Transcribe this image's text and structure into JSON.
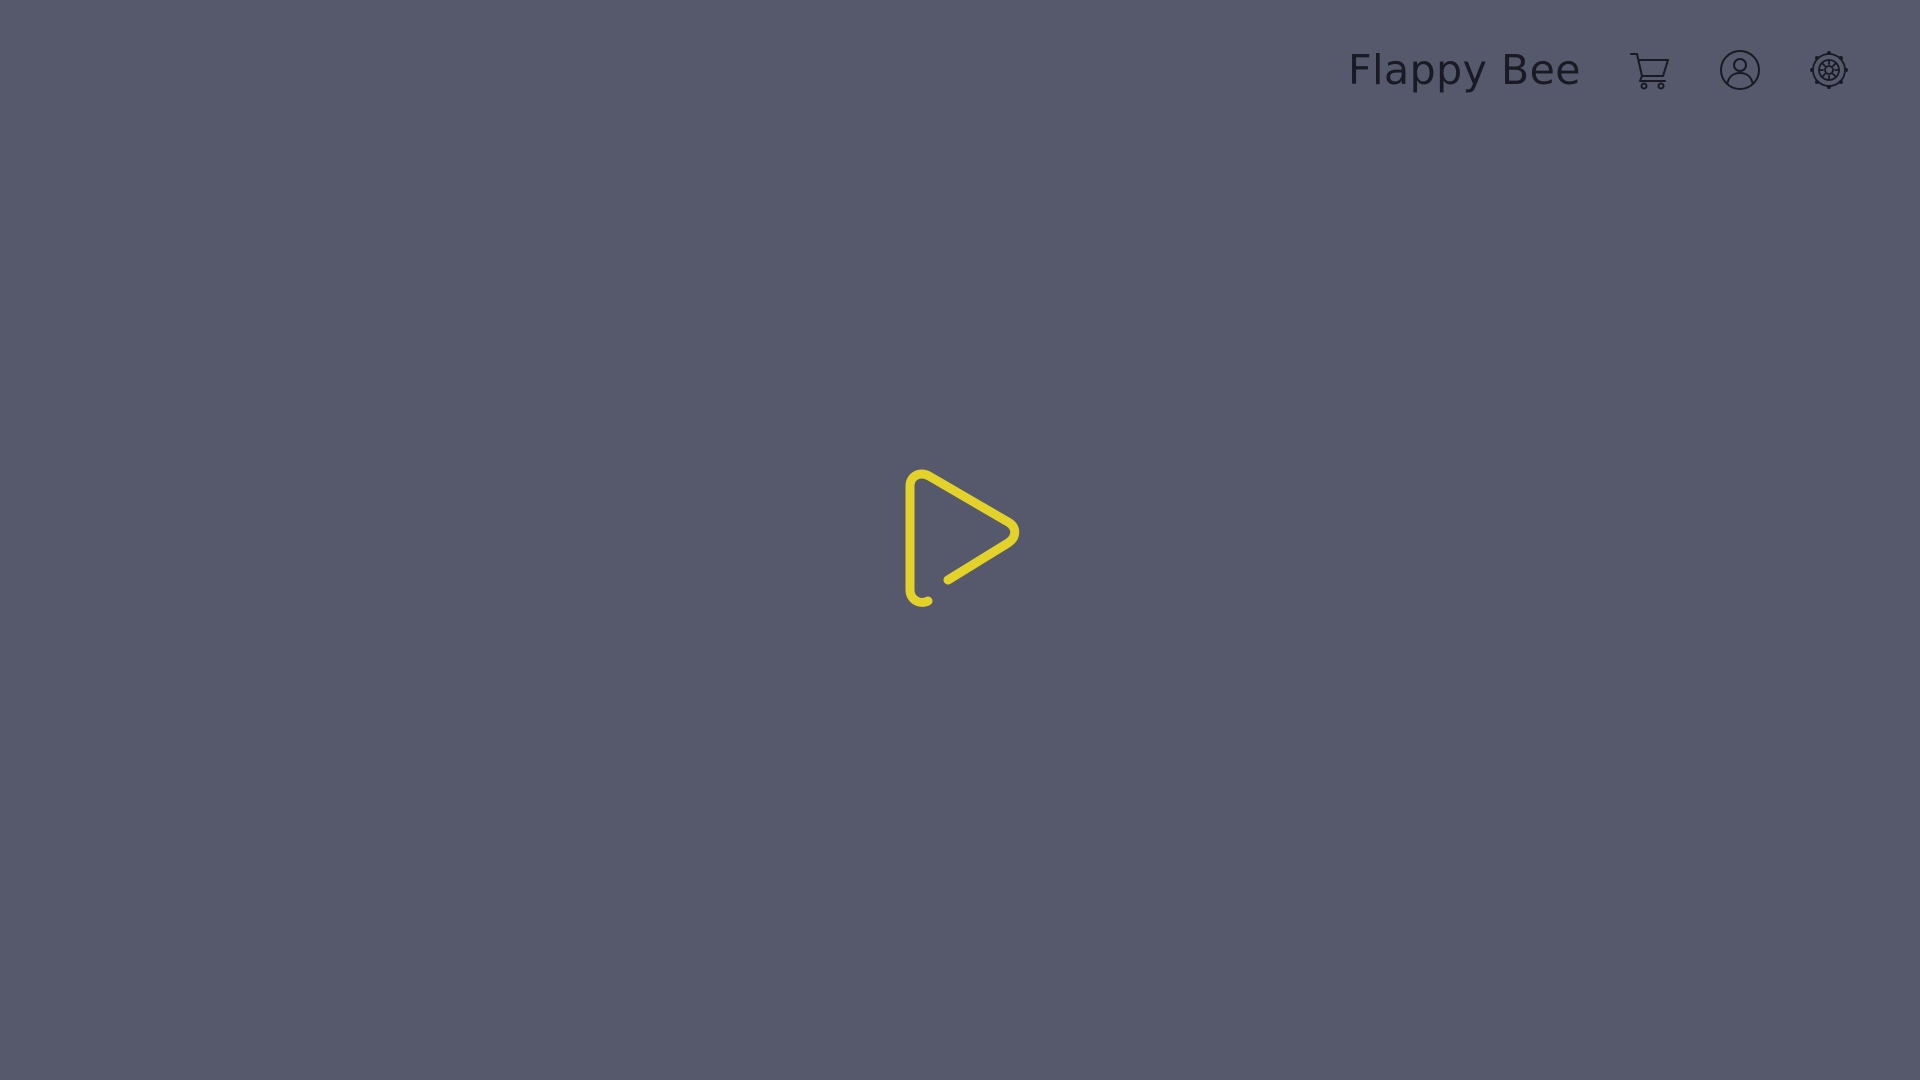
{
  "header": {
    "title": "Flappy Bee",
    "icons": {
      "cart": "cart-icon",
      "profile": "user-circle-icon",
      "settings": "gear-icon"
    }
  },
  "main": {
    "play_icon": "play-icon"
  },
  "colors": {
    "background": "#56596c",
    "accent": "#e2d22a",
    "icon_stroke": "#1a1a24"
  }
}
